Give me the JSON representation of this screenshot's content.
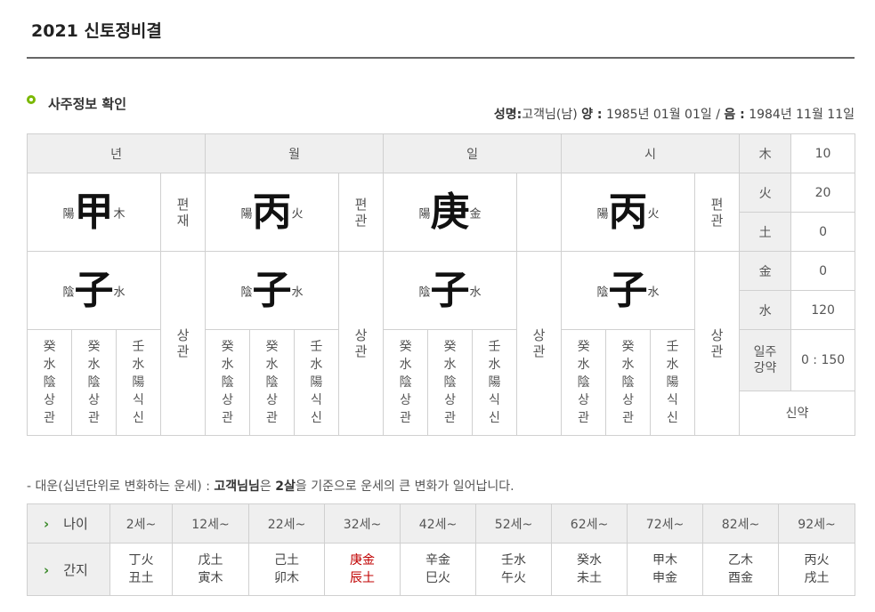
{
  "page": {
    "title": "2021 신토정비결"
  },
  "section": {
    "title": "사주정보 확인"
  },
  "person": {
    "name_label": "성명:",
    "name": "고객님(남)",
    "solar_label": "양 :",
    "solar": "1985년 01월 01일",
    "sep": "/",
    "lunar_label": "음 :",
    "lunar": "1984년 11월 11일"
  },
  "pillars": [
    {
      "header": "년",
      "stem": {
        "yinyang": "陽",
        "char": "甲",
        "element": "木"
      },
      "stem_rel": [
        "편",
        "재"
      ],
      "branch": {
        "yinyang": "陰",
        "char": "子",
        "element": "水"
      },
      "branch_rel": [
        "상",
        "관"
      ],
      "hidden": [
        [
          "癸",
          "水",
          "陰",
          "상",
          "관"
        ],
        [
          "癸",
          "水",
          "陰",
          "상",
          "관"
        ],
        [
          "壬",
          "水",
          "陽",
          "식",
          "신"
        ]
      ]
    },
    {
      "header": "월",
      "stem": {
        "yinyang": "陽",
        "char": "丙",
        "element": "火"
      },
      "stem_rel": [
        "편",
        "관"
      ],
      "branch": {
        "yinyang": "陰",
        "char": "子",
        "element": "水"
      },
      "branch_rel": [
        "상",
        "관"
      ],
      "hidden": [
        [
          "癸",
          "水",
          "陰",
          "상",
          "관"
        ],
        [
          "癸",
          "水",
          "陰",
          "상",
          "관"
        ],
        [
          "壬",
          "水",
          "陽",
          "식",
          "신"
        ]
      ]
    },
    {
      "header": "일",
      "stem": {
        "yinyang": "陽",
        "char": "庚",
        "element": "金"
      },
      "stem_rel": [
        "",
        ""
      ],
      "branch": {
        "yinyang": "陰",
        "char": "子",
        "element": "水"
      },
      "branch_rel": [
        "상",
        "관"
      ],
      "hidden": [
        [
          "癸",
          "水",
          "陰",
          "상",
          "관"
        ],
        [
          "癸",
          "水",
          "陰",
          "상",
          "관"
        ],
        [
          "壬",
          "水",
          "陽",
          "식",
          "신"
        ]
      ]
    },
    {
      "header": "시",
      "stem": {
        "yinyang": "陽",
        "char": "丙",
        "element": "火"
      },
      "stem_rel": [
        "편",
        "관"
      ],
      "branch": {
        "yinyang": "陰",
        "char": "子",
        "element": "水"
      },
      "branch_rel": [
        "상",
        "관"
      ],
      "hidden": [
        [
          "癸",
          "水",
          "陰",
          "상",
          "관"
        ],
        [
          "癸",
          "水",
          "陰",
          "상",
          "관"
        ],
        [
          "壬",
          "水",
          "陽",
          "식",
          "신"
        ]
      ]
    }
  ],
  "elements": [
    {
      "name": "木",
      "value": "10"
    },
    {
      "name": "火",
      "value": "20"
    },
    {
      "name": "土",
      "value": "0"
    },
    {
      "name": "金",
      "value": "0"
    },
    {
      "name": "水",
      "value": "120"
    }
  ],
  "balance": {
    "label_1": "일주",
    "label_2": "강약",
    "value": "0 : 150",
    "result": "신약"
  },
  "daeun": {
    "note_prefix": "- 대운(십년단위로 변화하는 운세) : ",
    "note_name": "고객님님",
    "note_mid": "은 ",
    "note_age": "2살",
    "note_suffix": "을 기준으로 운세의 큰 변화가 일어납니다.",
    "chevron": "›",
    "age_label": "나이",
    "ganji_label": "간지",
    "columns": [
      {
        "age": "2세~",
        "top": "丁火",
        "bottom": "丑土",
        "highlight": false
      },
      {
        "age": "12세~",
        "top": "戊土",
        "bottom": "寅木",
        "highlight": false
      },
      {
        "age": "22세~",
        "top": "己土",
        "bottom": "卯木",
        "highlight": false
      },
      {
        "age": "32세~",
        "top": "庚金",
        "bottom": "辰土",
        "highlight": true
      },
      {
        "age": "42세~",
        "top": "辛金",
        "bottom": "巳火",
        "highlight": false
      },
      {
        "age": "52세~",
        "top": "壬水",
        "bottom": "午火",
        "highlight": false
      },
      {
        "age": "62세~",
        "top": "癸水",
        "bottom": "未土",
        "highlight": false
      },
      {
        "age": "72세~",
        "top": "甲木",
        "bottom": "申金",
        "highlight": false
      },
      {
        "age": "82세~",
        "top": "乙木",
        "bottom": "酉金",
        "highlight": false
      },
      {
        "age": "92세~",
        "top": "丙火",
        "bottom": "戌土",
        "highlight": false
      }
    ]
  }
}
